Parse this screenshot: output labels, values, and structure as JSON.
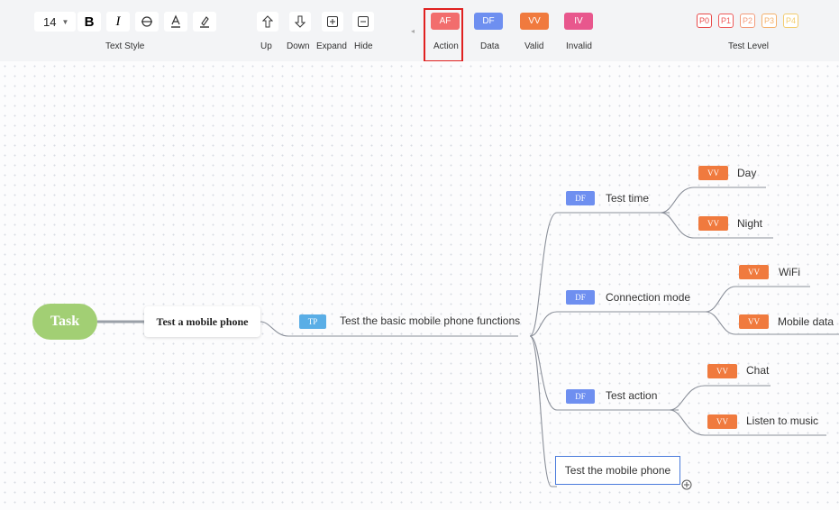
{
  "toolbar": {
    "font_size": "14",
    "groups": {
      "text_style": "Text Style",
      "test_level": "Test Level"
    },
    "nav": {
      "up": "Up",
      "down": "Down",
      "expand": "Expand",
      "hide": "Hide"
    },
    "tags": {
      "action": {
        "badge": "AF",
        "label": "Action",
        "color": "#f26d6d"
      },
      "data": {
        "badge": "DF",
        "label": "Data",
        "color": "#6e8ff0"
      },
      "valid": {
        "badge": "VV",
        "label": "Valid",
        "color": "#f07a3e"
      },
      "invalid": {
        "badge": "IV",
        "label": "Invalid",
        "color": "#e8578d"
      }
    },
    "levels": [
      {
        "label": "P0",
        "color": "#e84a4a"
      },
      {
        "label": "P1",
        "color": "#ee5a5a"
      },
      {
        "label": "P2",
        "color": "#f39a7a"
      },
      {
        "label": "P3",
        "color": "#f5b16c"
      },
      {
        "label": "P4",
        "color": "#f3cc6d"
      }
    ],
    "highlight_color": "#e02020"
  },
  "mindmap": {
    "root": "Task",
    "level1": "Test a mobile phone",
    "level2": {
      "badge": "TP",
      "text": "Test the basic mobile phone functions"
    },
    "branches": [
      {
        "badge": "DF",
        "text": "Test time",
        "leaves": [
          {
            "badge": "VV",
            "text": "Day"
          },
          {
            "badge": "VV",
            "text": "Night"
          }
        ]
      },
      {
        "badge": "DF",
        "text": "Connection mode",
        "leaves": [
          {
            "badge": "VV",
            "text": "WiFi"
          },
          {
            "badge": "VV",
            "text": "Mobile data"
          }
        ]
      },
      {
        "badge": "DF",
        "text": "Test action",
        "leaves": [
          {
            "badge": "VV",
            "text": "Chat"
          },
          {
            "badge": "VV",
            "text": "Listen to music"
          }
        ]
      }
    ],
    "editing_node": "Test the mobile phone",
    "colors": {
      "root": "#a2cf74",
      "tp": "#5aaee6",
      "df": "#6e8ff0",
      "vv": "#f07a3e",
      "line": "#8a8f99"
    }
  }
}
